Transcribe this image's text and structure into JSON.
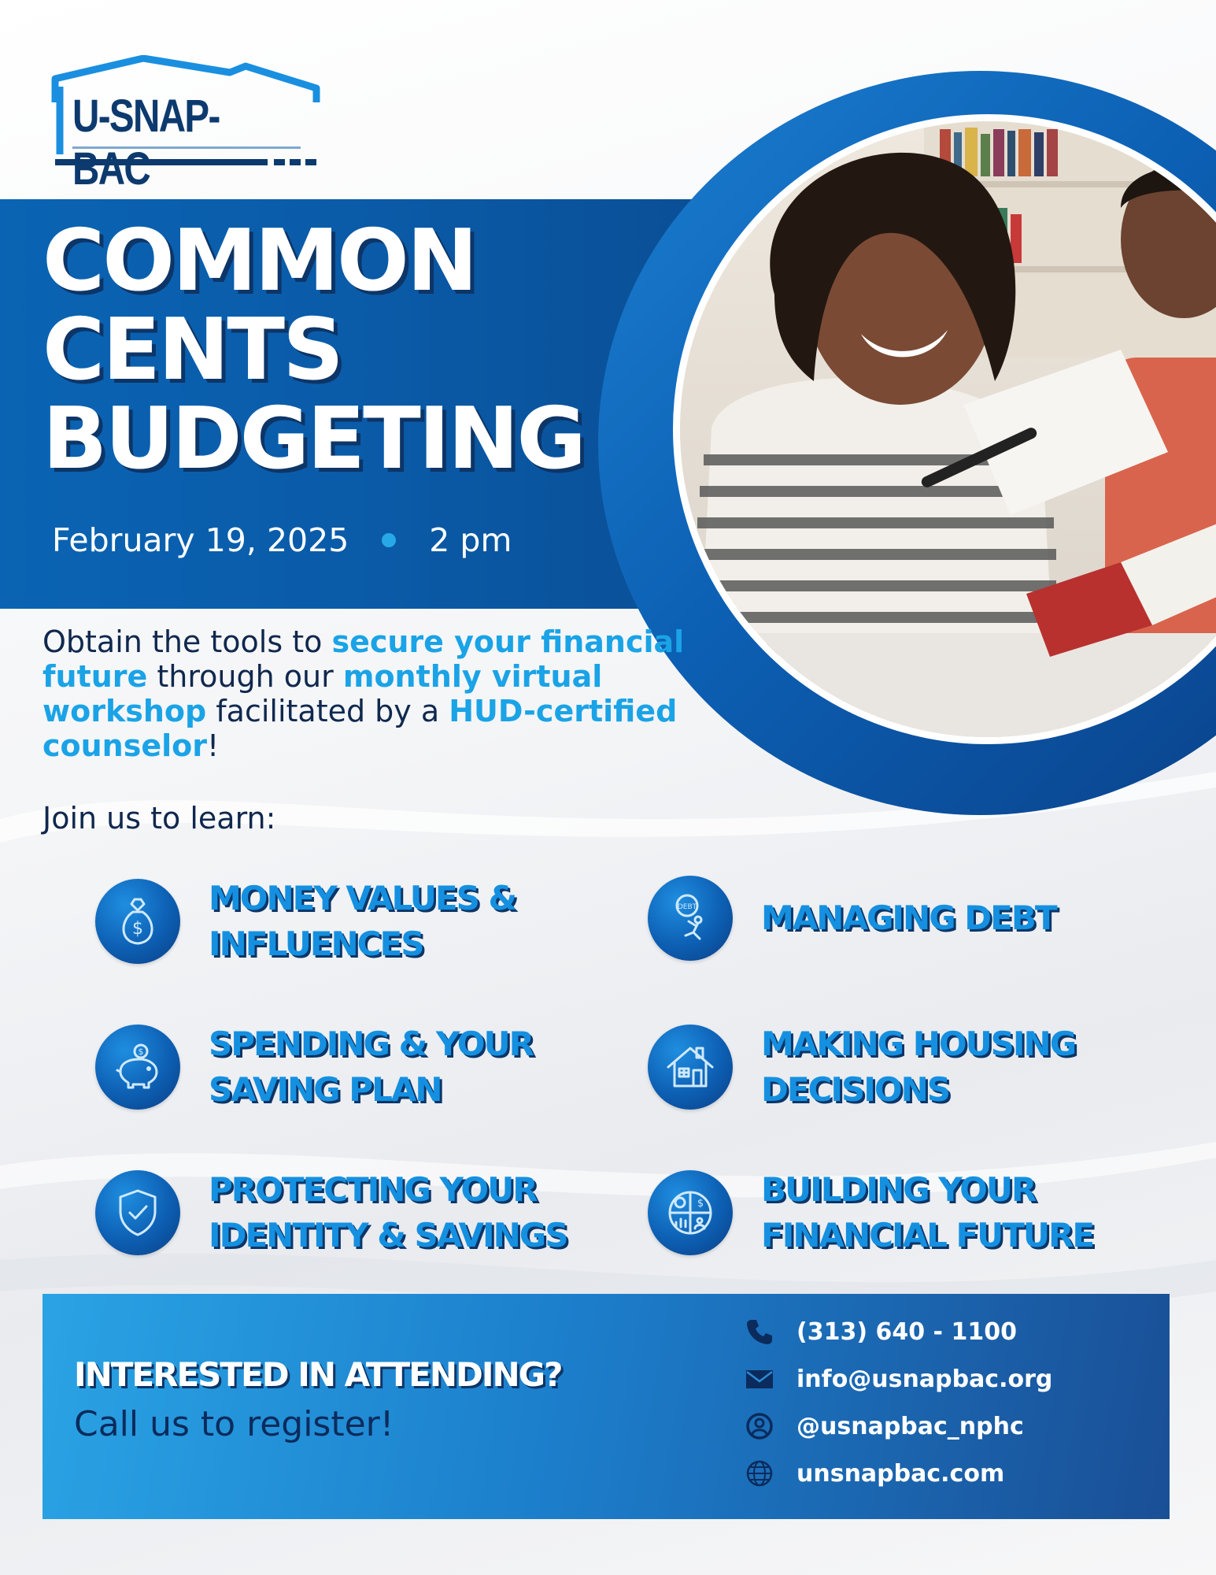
{
  "logo": {
    "text": "U-SNAP-BAC"
  },
  "title": {
    "line1": "COMMON",
    "line2": "CENTS",
    "line3": "BUDGETING"
  },
  "event": {
    "date": "February 19, 2025",
    "time": "2 pm"
  },
  "intro": {
    "t1": "Obtain the tools to ",
    "h1": "secure your financial future",
    "t2": " through our ",
    "h2": "monthly virtual workshop",
    "t3": " facilitated by a ",
    "h3": "HUD-certified counselor",
    "t4": "!"
  },
  "join_text": "Join us to learn:",
  "topics": [
    {
      "line1": "MONEY VALUES &",
      "line2": "INFLUENCES",
      "icon": "money-bag-icon"
    },
    {
      "line1": "MANAGING DEBT",
      "line2": "",
      "icon": "debt-burden-icon"
    },
    {
      "line1": "SPENDING & YOUR",
      "line2": "SAVING PLAN",
      "icon": "piggy-bank-icon"
    },
    {
      "line1": "MAKING HOUSING",
      "line2": "DECISIONS",
      "icon": "house-icon"
    },
    {
      "line1": "PROTECTING YOUR",
      "line2": "IDENTITY & SAVINGS",
      "icon": "shield-check-icon"
    },
    {
      "line1": "BUILDING YOUR",
      "line2": "FINANCIAL FUTURE",
      "icon": "finance-chart-icon"
    }
  ],
  "footer": {
    "cta": "INTERESTED IN ATTENDING?",
    "sub": "Call us to register!",
    "contacts": [
      {
        "icon": "phone-icon",
        "text": "(313) 640 - 1100"
      },
      {
        "icon": "mail-icon",
        "text": "info@usnapbac.org"
      },
      {
        "icon": "user-circle-icon",
        "text": "@usnapbac_nphc"
      },
      {
        "icon": "globe-icon",
        "text": "unsnapbac.com"
      }
    ]
  },
  "colors": {
    "primary_blue": "#0a5aa7",
    "accent_blue": "#1aa3e6",
    "navy": "#0d3567",
    "text_dark": "#10284e"
  }
}
